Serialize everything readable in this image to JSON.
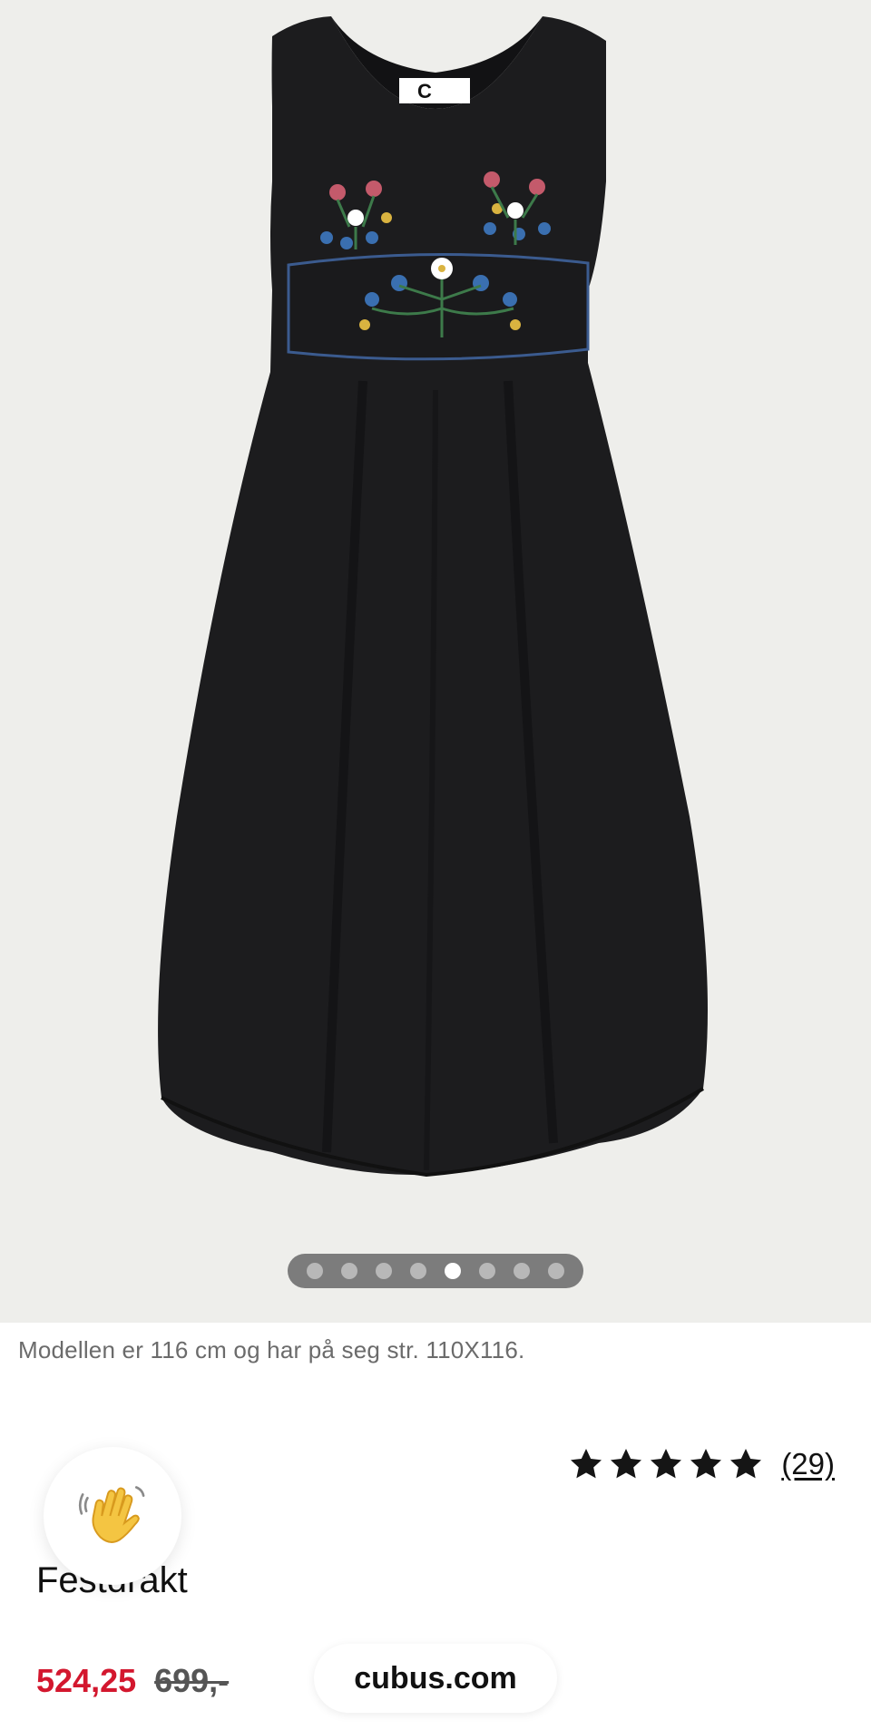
{
  "gallery": {
    "image": "product-photo-black-bunad-dress",
    "tag_brand": "C",
    "dot_count": 8,
    "active_dot_index": 4
  },
  "model_note": "Modellen er 116 cm og har på seg str. 110X116.",
  "rating": {
    "stars": 5,
    "review_count": "(29)"
  },
  "chat_bubble_icon": "waving-hand-icon",
  "product": {
    "name": "Festdrakt",
    "price_sale": "524,25",
    "price_original": "699,-"
  },
  "site": {
    "domain": "cubus.com"
  },
  "colors": {
    "sale_price": "#d3172e",
    "gallery_bg": "#eeeeeb",
    "dress": "#1c1c1e"
  }
}
